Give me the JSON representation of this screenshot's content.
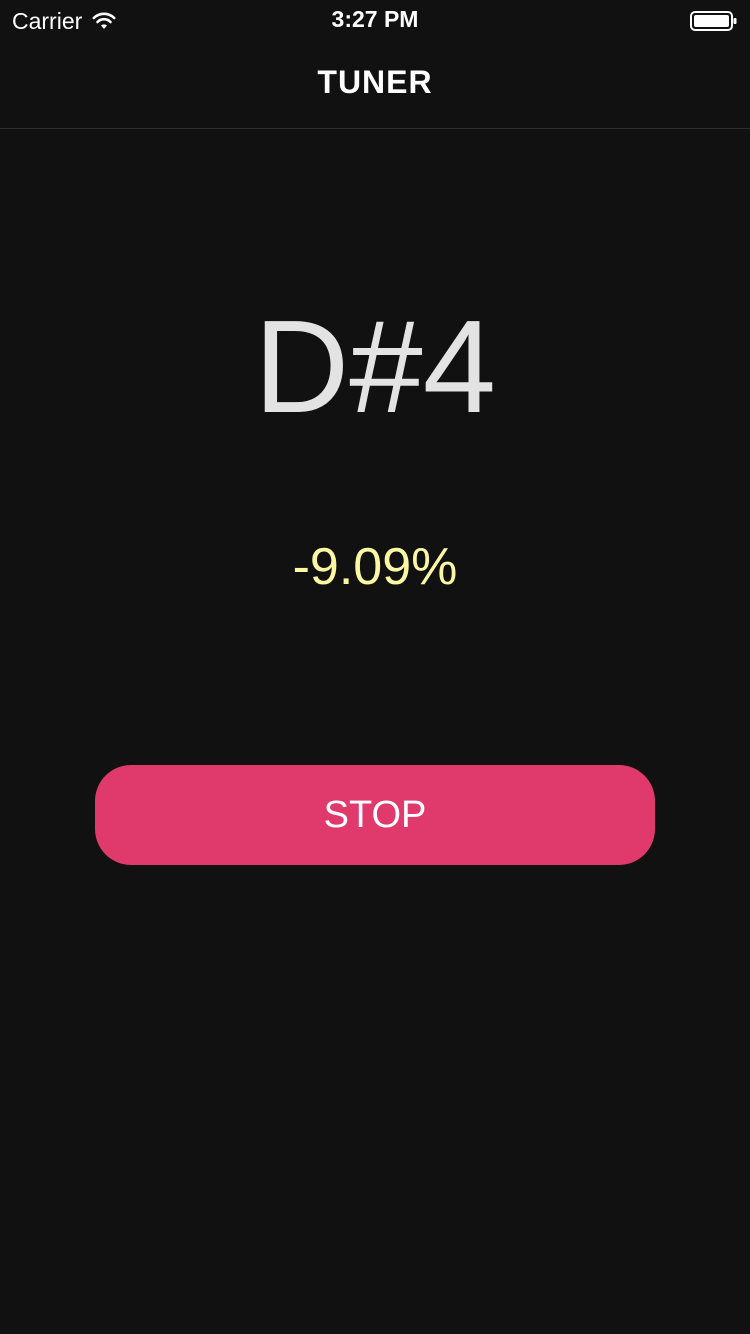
{
  "status_bar": {
    "carrier": "Carrier",
    "time": "3:27 PM",
    "wifi_icon": "wifi-icon",
    "battery_icon": "battery-icon"
  },
  "nav": {
    "title": "TUNER"
  },
  "tuner": {
    "note": "D#4",
    "deviation": "-9.09%"
  },
  "actions": {
    "stop_label": "STOP"
  },
  "colors": {
    "background": "#111111",
    "note": "#e3e3e3",
    "deviation": "#fbf7a3",
    "stop_button": "#e03a6d"
  }
}
